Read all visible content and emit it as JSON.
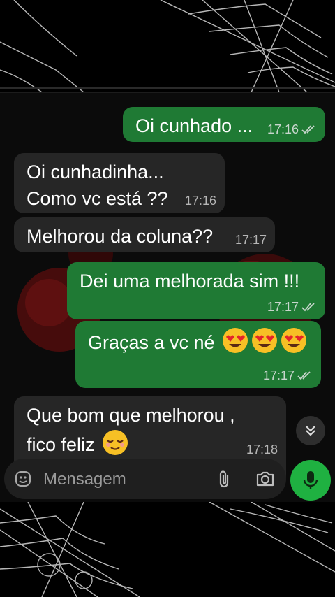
{
  "messages": [
    {
      "direction": "out",
      "text": "Oi cunhado ...",
      "time": "17:16",
      "status": "read"
    },
    {
      "direction": "in",
      "text": "Oi cunhadinha...\nComo vc está ??",
      "time": "17:16"
    },
    {
      "direction": "in",
      "text": "Melhorou da coluna??",
      "time": "17:17"
    },
    {
      "direction": "out",
      "text": "Dei uma melhorada sim !!!",
      "time": "17:17",
      "status": "read"
    },
    {
      "direction": "out",
      "text": "Graças a vc né",
      "emoji": [
        "heart-eyes",
        "heart-eyes",
        "heart-eyes"
      ],
      "time": "17:17",
      "status": "read"
    },
    {
      "direction": "in",
      "text": "Que bom que melhorou ,\nfico feliz",
      "emoji": [
        "relieved-face"
      ],
      "time": "17:18"
    }
  ],
  "composer": {
    "placeholder": "Mensagem",
    "icons": [
      "sticker-icon",
      "attach-icon",
      "camera-icon"
    ],
    "send_icon": "mic-icon"
  },
  "colors": {
    "outgoing_bubble": "#1f7a34",
    "incoming_bubble": "#262626",
    "accent": "#1fb141",
    "background": "#000000"
  }
}
